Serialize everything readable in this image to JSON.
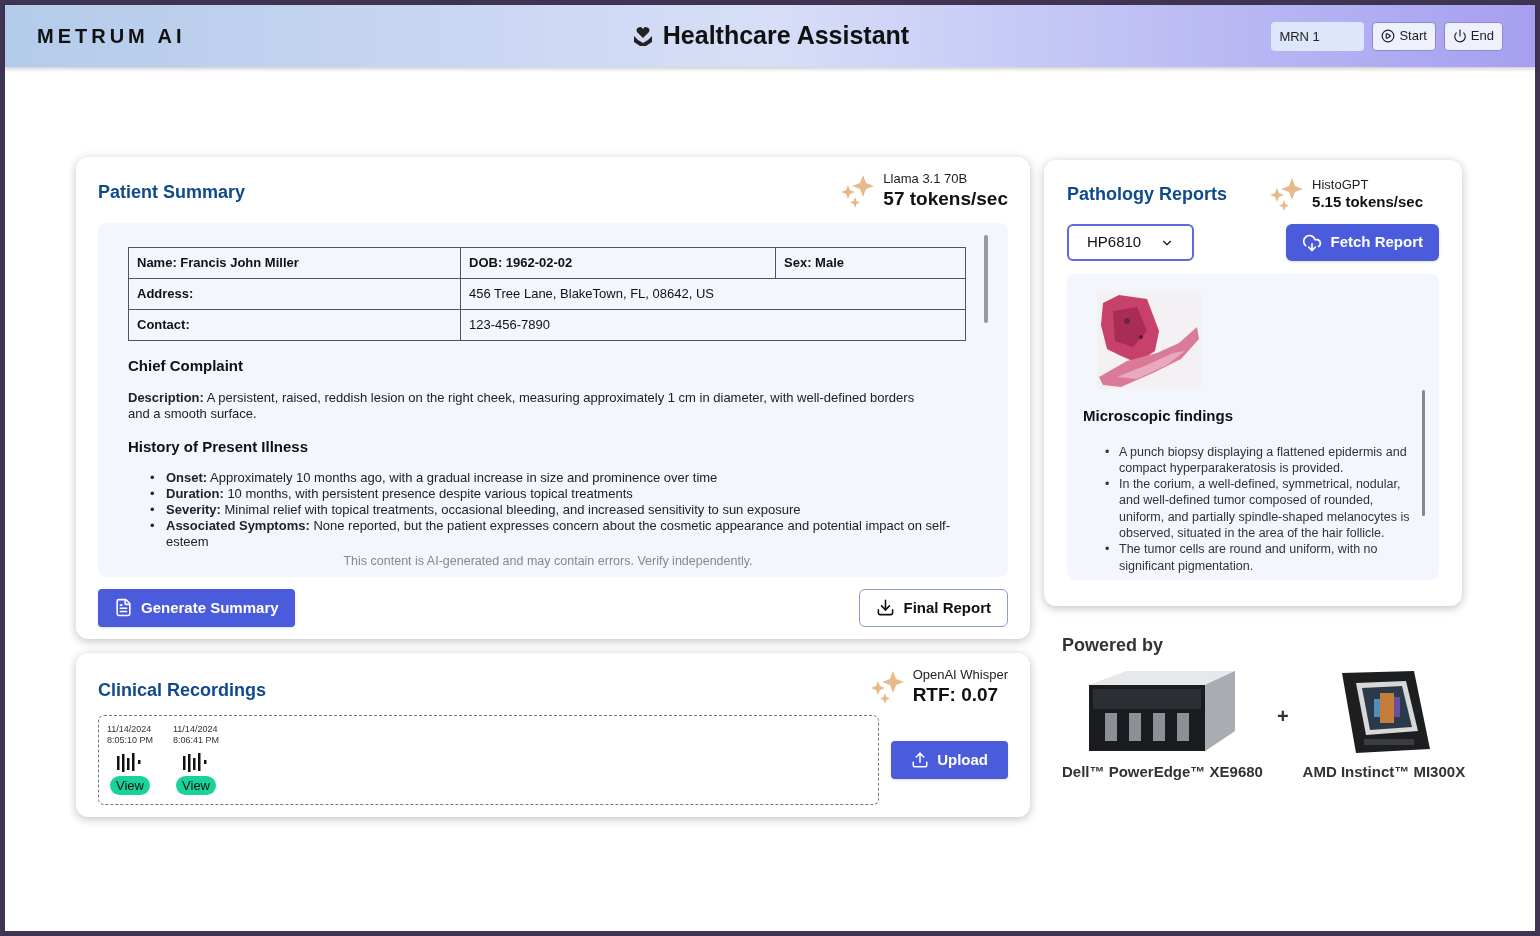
{
  "header": {
    "logo": "METRUM AI",
    "title": "Healthcare Assistant",
    "mrn_field": "MRN 1",
    "buttons": [
      {
        "label": "Start",
        "kind": "start"
      },
      {
        "label": "End",
        "kind": "end"
      }
    ]
  },
  "patient_summary": {
    "title": "Patient Summary",
    "model": {
      "name": "Llama 3.1 70B",
      "metric": "57 tokens/sec"
    },
    "table": [
      [
        {
          "text": "Name: Francis John Miller",
          "bold": true
        },
        {
          "text": "DOB: 1962-02-02",
          "bold": true
        },
        {
          "text": "Sex: Male",
          "bold": true
        }
      ],
      [
        {
          "text": "Address:",
          "bold": true
        },
        {
          "text": "456 Tree Lane, BlakeTown, FL, 08642, US",
          "bold": false
        }
      ],
      [
        {
          "text": "Contact:",
          "bold": true
        },
        {
          "text": "123-456-7890",
          "bold": false
        }
      ]
    ],
    "sections": [
      {
        "heading": "Chief Complaint",
        "paragraph": "**Description:** A persistent, raised, reddish lesion on the right cheek, measuring approximately 1 cm in diameter, with well-defined borders and a smooth surface."
      },
      {
        "heading": "History of Present Illness",
        "bullets": [
          {
            "marker": "•",
            "text": "**Onset:** Approximately 10 months ago, with a gradual increase in size and prominence over time"
          },
          {
            "marker": "•",
            "text": "**Duration:** 10 months, with persistent presence despite various topical treatments"
          },
          {
            "marker": "•",
            "text": "**Severity:** Minimal relief with topical treatments, occasional bleeding, and increased sensitivity to sun exposure"
          },
          {
            "marker": "•",
            "text": "**Associated Symptoms:** None reported, but the patient expresses concern about the cosmetic appearance and potential impact on self-esteem"
          }
        ]
      }
    ],
    "disclaimer": "This content is AI-generated and may contain errors. Verify independently.",
    "buttons": [
      {
        "label": "Generate Summary",
        "kind": "primary"
      },
      {
        "label": "Final Report",
        "kind": "outline"
      }
    ]
  },
  "pathology": {
    "title": "Pathology Reports",
    "model": {
      "name": "HistoGPT",
      "metric": "5.15 tokens/sec"
    },
    "select_value": "HP6810",
    "fetch_button": "Fetch Report",
    "findings_heading": "Microscopic findings",
    "findings": [
      {
        "marker": "•",
        "text": "A punch biopsy displaying a flattened epidermis and compact hyperparakeratosis is provided."
      },
      {
        "marker": "•",
        "text": "In the corium, a well-defined, symmetrical, nodular, and well-defined tumor composed of rounded, uniform, and partially spindle-shaped melanocytes is observed, situated in the area of the hair follicle."
      },
      {
        "marker": "•",
        "text": "The tumor cells are round and uniform, with no significant pigmentation."
      }
    ]
  },
  "recordings": {
    "title": "Clinical Recordings",
    "model": {
      "name": "OpenAI Whisper",
      "metric": "RTF: 0.07"
    },
    "items": [
      {
        "date": "11/14/2024",
        "time": "8:05:10 PM",
        "action": "View"
      },
      {
        "date": "11/14/2024",
        "time": "8:06:41 PM",
        "action": "View"
      }
    ],
    "upload_button": "Upload"
  },
  "powered_by": {
    "title": "Powered by",
    "joiner": "+",
    "items": [
      {
        "label": "Dell™ PowerEdge™ XE9680",
        "kind": "server"
      },
      {
        "label": "AMD Instinct™ MI300X",
        "kind": "chip"
      }
    ]
  }
}
